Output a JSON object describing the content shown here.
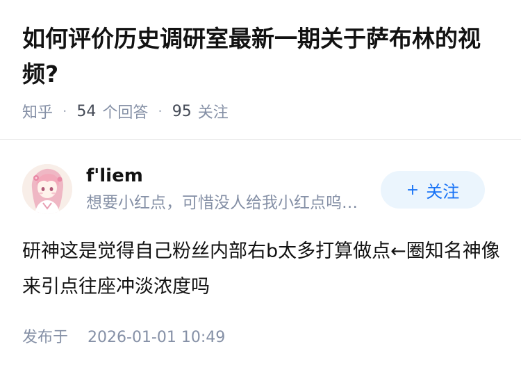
{
  "question": {
    "title": "如何评价历史调研室最新一期关于萨布林的视频?",
    "source": "知乎",
    "answer_count": "54",
    "answer_suffix": "个回答",
    "follow_count": "95",
    "follow_suffix": "关注"
  },
  "author": {
    "name": "f'liem",
    "bio": "想要小红点，可惜没人给我小红点呜呜呜",
    "follow_label": "关注",
    "follow_icon": "plus-icon"
  },
  "answer": {
    "content": "研神这是觉得自己粉丝内部右b太多打算做点←圈知名神像来引点往座冲淡浓度吗",
    "published_label": "发布于",
    "published_time": "2026-01-01 10:49"
  },
  "colors": {
    "title": "#121212",
    "meta": "#8590a6",
    "accent": "#1772f6",
    "button_bg": "#ebf5fd"
  }
}
